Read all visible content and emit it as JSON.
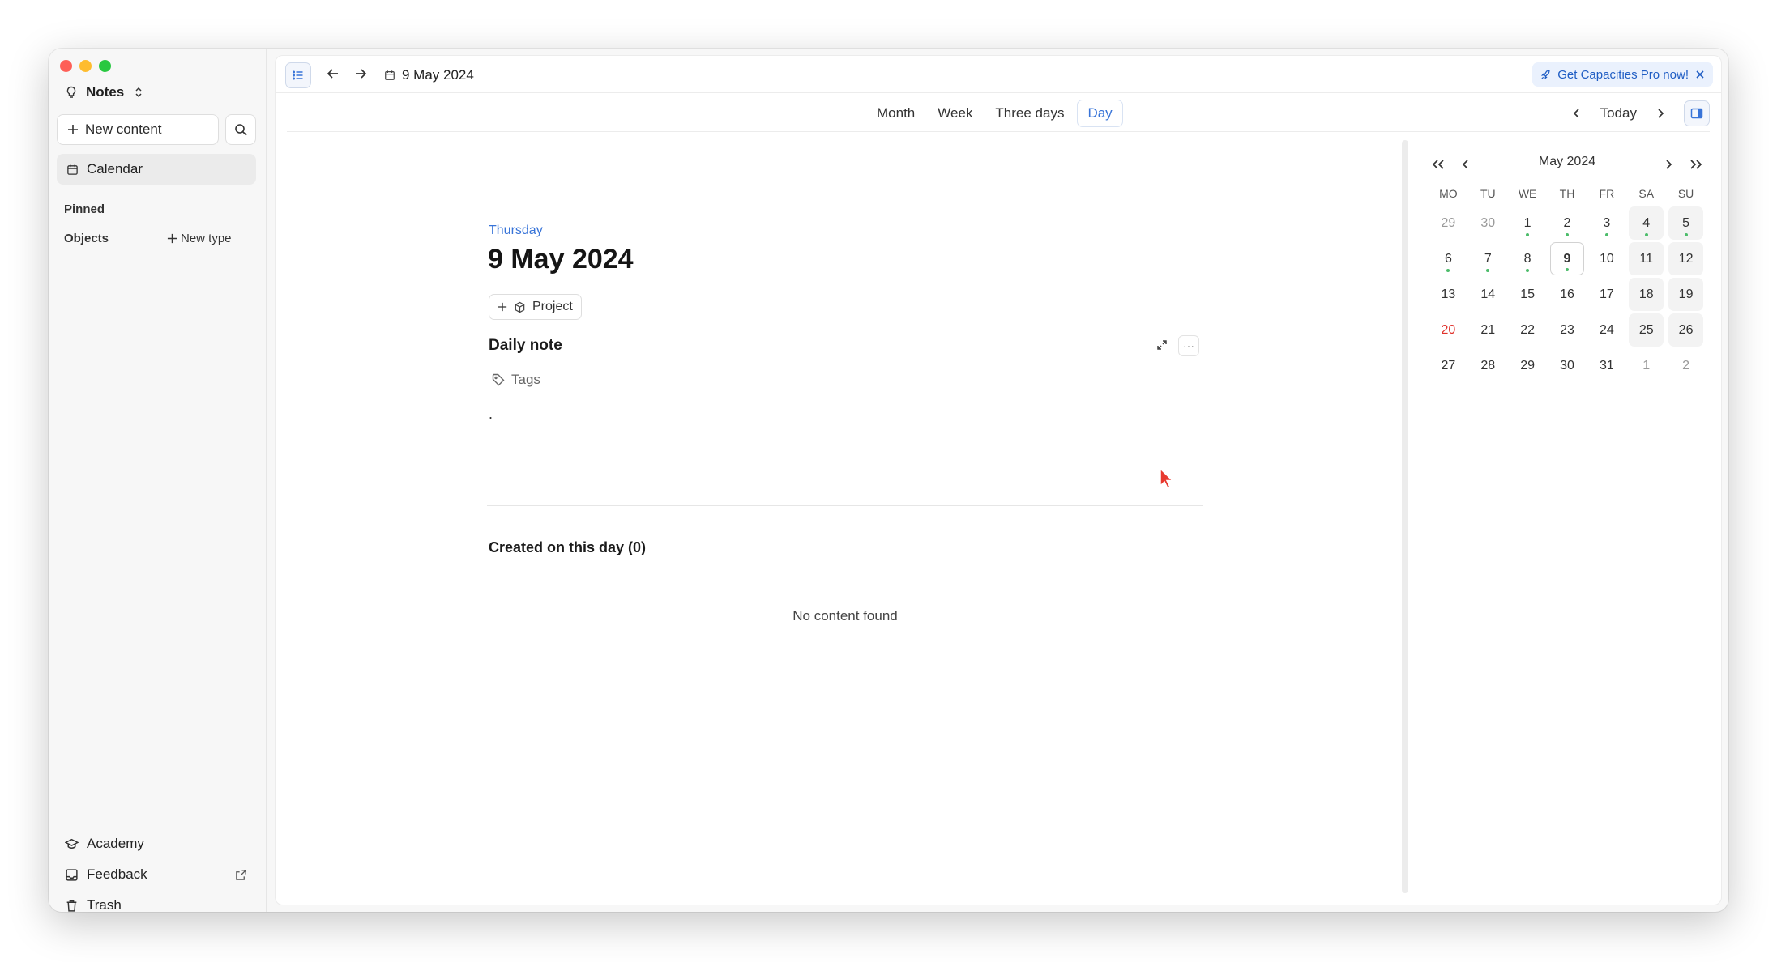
{
  "sidebar": {
    "space_name": "Notes",
    "new_content_label": "New content",
    "calendar_label": "Calendar",
    "pinned_label": "Pinned",
    "objects_label": "Objects",
    "new_type_label": "New type",
    "bottom": {
      "academy": "Academy",
      "feedback": "Feedback",
      "trash": "Trash"
    },
    "icons": [
      "settings-icon",
      "command-icon",
      "moon-icon",
      "user-icon"
    ]
  },
  "topbar": {
    "breadcrumb_date": "9 May 2024",
    "pro_banner": "Get Capacities Pro now!"
  },
  "views": {
    "tabs": [
      "Month",
      "Week",
      "Three days",
      "Day"
    ],
    "active": "Day",
    "today_label": "Today"
  },
  "day": {
    "weekday": "Thursday",
    "title": "9 May 2024",
    "project_label": "Project",
    "daily_note_title": "Daily note",
    "tags_label": "Tags",
    "note_content": ".",
    "created_title": "Created on this day (0)",
    "empty_text": "No content found"
  },
  "mini_calendar": {
    "month_label": "May 2024",
    "weekdays": [
      "MO",
      "TU",
      "WE",
      "TH",
      "FR",
      "SA",
      "SU"
    ],
    "weeks": [
      [
        {
          "d": "29",
          "muted": true
        },
        {
          "d": "30",
          "muted": true
        },
        {
          "d": "1",
          "dot": true
        },
        {
          "d": "2",
          "dot": true
        },
        {
          "d": "3",
          "dot": true
        },
        {
          "d": "4",
          "dot": true
        },
        {
          "d": "5",
          "dot": true
        }
      ],
      [
        {
          "d": "6",
          "dot": true
        },
        {
          "d": "7",
          "dot": true
        },
        {
          "d": "8",
          "dot": true
        },
        {
          "d": "9",
          "dot": true,
          "today": true
        },
        {
          "d": "10"
        },
        {
          "d": "11"
        },
        {
          "d": "12"
        }
      ],
      [
        {
          "d": "13"
        },
        {
          "d": "14"
        },
        {
          "d": "15"
        },
        {
          "d": "16"
        },
        {
          "d": "17"
        },
        {
          "d": "18"
        },
        {
          "d": "19"
        }
      ],
      [
        {
          "d": "20",
          "red": true
        },
        {
          "d": "21"
        },
        {
          "d": "22"
        },
        {
          "d": "23"
        },
        {
          "d": "24"
        },
        {
          "d": "25"
        },
        {
          "d": "26"
        }
      ],
      [
        {
          "d": "27"
        },
        {
          "d": "28"
        },
        {
          "d": "29"
        },
        {
          "d": "30"
        },
        {
          "d": "31"
        },
        {
          "d": "1",
          "muted": true
        },
        {
          "d": "2",
          "muted": true
        }
      ]
    ]
  },
  "colors": {
    "accent": "#3874d8",
    "holiday_red": "#e0322c",
    "dot_green": "#4cbc6a"
  }
}
